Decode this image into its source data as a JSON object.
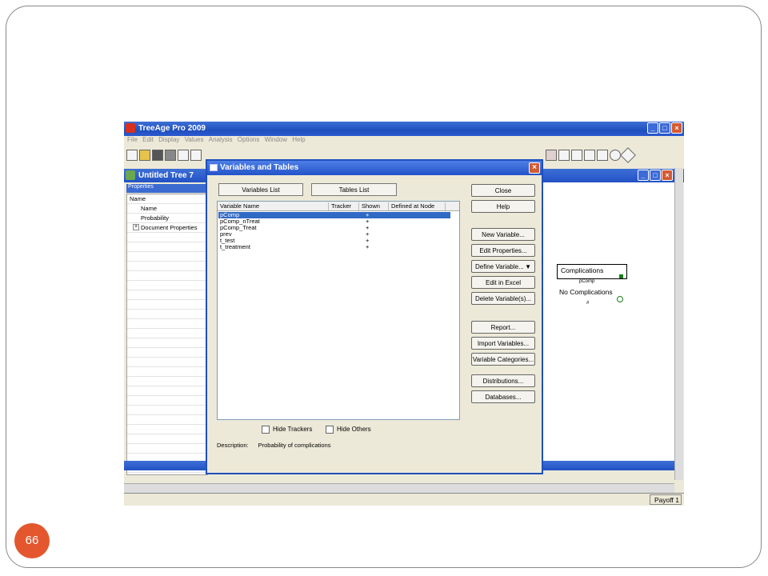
{
  "slide": {
    "page_number": "66"
  },
  "app": {
    "title": "TreeAge Pro 2009",
    "menus": [
      "File",
      "Edit",
      "Display",
      "Values",
      "Analysis",
      "Options",
      "Window",
      "Help"
    ]
  },
  "tree_window": {
    "title": "Untitled Tree 7"
  },
  "properties": {
    "header": "Properties",
    "column": "Name",
    "items": [
      "Name",
      "Probability",
      "Document Properties"
    ],
    "expand_glyph": "+"
  },
  "tree": {
    "branch1": "Complications",
    "prob": "pComp",
    "branch2": "No Complications",
    "hash": "#"
  },
  "dialog": {
    "title": "Variables and Tables",
    "tabs": [
      "Variables List",
      "Tables List"
    ],
    "columns": [
      "Variable Name",
      "Tracker",
      "Shown",
      "Defined at Node"
    ],
    "rows": [
      {
        "name": "pComp",
        "shown": "+"
      },
      {
        "name": "pComp_nTreat",
        "shown": "+"
      },
      {
        "name": "pComp_Treat",
        "shown": "+"
      },
      {
        "name": "prev",
        "shown": "+"
      },
      {
        "name": "t_test",
        "shown": "+"
      },
      {
        "name": "t_treatment",
        "shown": "+"
      }
    ],
    "buttons": [
      "Close",
      "Help",
      "New Variable...",
      "Edit Properties...",
      "Define Variable...",
      "Edit in Excel",
      "Delete Variable(s)...",
      "Report...",
      "Import Variables...",
      "Variable Categories...",
      "Distributions...",
      "Databases..."
    ],
    "dropdown_glyph": "▼",
    "checkboxes": [
      "Hide Trackers",
      "Hide Others"
    ],
    "description_label": "Description:",
    "description_value": "Probability of complications"
  },
  "status": {
    "payoff": "Payoff 1"
  },
  "colors": {
    "xp_blue": "#2352c4",
    "selection": "#316ac5",
    "slide_badge": "#e4572e"
  }
}
